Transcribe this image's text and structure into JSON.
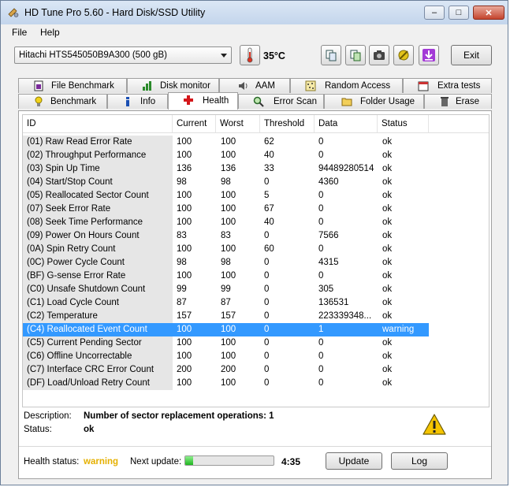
{
  "window": {
    "title": "HD Tune Pro 5.60 - Hard Disk/SSD Utility",
    "minimize_glyph": "–",
    "maximize_glyph": "□",
    "close_glyph": "✕"
  },
  "menu": {
    "file": "File",
    "help": "Help"
  },
  "toolbar": {
    "drive": "Hitachi HTS545050B9A300 (500 gB)",
    "temperature": "35°C",
    "exit_label": "Exit",
    "icons": [
      "copy-text-icon",
      "copy-info-icon",
      "screenshot-camera-icon",
      "options-wrench-icon",
      "save-down-arrow-icon"
    ]
  },
  "tabs_top": [
    {
      "label": "File Benchmark",
      "icon": "file-benchmark-icon"
    },
    {
      "label": "Disk monitor",
      "icon": "disk-monitor-icon"
    },
    {
      "label": "AAM",
      "icon": "aam-speaker-icon"
    },
    {
      "label": "Random Access",
      "icon": "random-access-icon"
    },
    {
      "label": "Extra tests",
      "icon": "extra-tests-icon"
    }
  ],
  "tabs_bottom": [
    {
      "label": "Benchmark",
      "icon": "benchmark-bulb-icon"
    },
    {
      "label": "Info",
      "icon": "info-icon"
    },
    {
      "label": "Health",
      "icon": "health-cross-icon"
    },
    {
      "label": "Error Scan",
      "icon": "error-scan-magnifier-icon"
    },
    {
      "label": "Folder Usage",
      "icon": "folder-usage-icon"
    },
    {
      "label": "Erase",
      "icon": "erase-trash-icon"
    }
  ],
  "active_tab": "Health",
  "table": {
    "headers": [
      "ID",
      "Current",
      "Worst",
      "Threshold",
      "Data",
      "Status"
    ],
    "rows": [
      [
        "(01) Raw Read Error Rate",
        "100",
        "100",
        "62",
        "0",
        "ok"
      ],
      [
        "(02) Throughput Performance",
        "100",
        "100",
        "40",
        "0",
        "ok"
      ],
      [
        "(03) Spin Up Time",
        "136",
        "136",
        "33",
        "94489280514",
        "ok"
      ],
      [
        "(04) Start/Stop Count",
        "98",
        "98",
        "0",
        "4360",
        "ok"
      ],
      [
        "(05) Reallocated Sector Count",
        "100",
        "100",
        "5",
        "0",
        "ok"
      ],
      [
        "(07) Seek Error Rate",
        "100",
        "100",
        "67",
        "0",
        "ok"
      ],
      [
        "(08) Seek Time Performance",
        "100",
        "100",
        "40",
        "0",
        "ok"
      ],
      [
        "(09) Power On Hours Count",
        "83",
        "83",
        "0",
        "7566",
        "ok"
      ],
      [
        "(0A) Spin Retry Count",
        "100",
        "100",
        "60",
        "0",
        "ok"
      ],
      [
        "(0C) Power Cycle Count",
        "98",
        "98",
        "0",
        "4315",
        "ok"
      ],
      [
        "(BF) G-sense Error Rate",
        "100",
        "100",
        "0",
        "0",
        "ok"
      ],
      [
        "(C0) Unsafe Shutdown Count",
        "99",
        "99",
        "0",
        "305",
        "ok"
      ],
      [
        "(C1) Load Cycle Count",
        "87",
        "87",
        "0",
        "136531",
        "ok"
      ],
      [
        "(C2) Temperature",
        "157",
        "157",
        "0",
        "223339348...",
        "ok"
      ],
      [
        "(C4) Reallocated Event Count",
        "100",
        "100",
        "0",
        "1",
        "warning"
      ],
      [
        "(C5) Current Pending Sector",
        "100",
        "100",
        "0",
        "0",
        "ok"
      ],
      [
        "(C6) Offline Uncorrectable",
        "100",
        "100",
        "0",
        "0",
        "ok"
      ],
      [
        "(C7) Interface CRC Error Count",
        "200",
        "200",
        "0",
        "0",
        "ok"
      ],
      [
        "(DF) Load/Unload Retry Count",
        "100",
        "100",
        "0",
        "0",
        "ok"
      ]
    ],
    "selected_row": 14
  },
  "details": {
    "description_label": "Description:",
    "description_value": "Number of sector replacement operations: 1",
    "status_label": "Status:",
    "status_value": "ok"
  },
  "footer": {
    "health_label": "Health status:",
    "health_value": "warning",
    "health_color": "#e5b000",
    "next_update_label": "Next update:",
    "progress_fraction": 0.09,
    "time": "4:35",
    "update_label": "Update",
    "log_label": "Log"
  },
  "colors": {
    "selection": "#3399ff",
    "warning_yellow": "#f5c400"
  }
}
